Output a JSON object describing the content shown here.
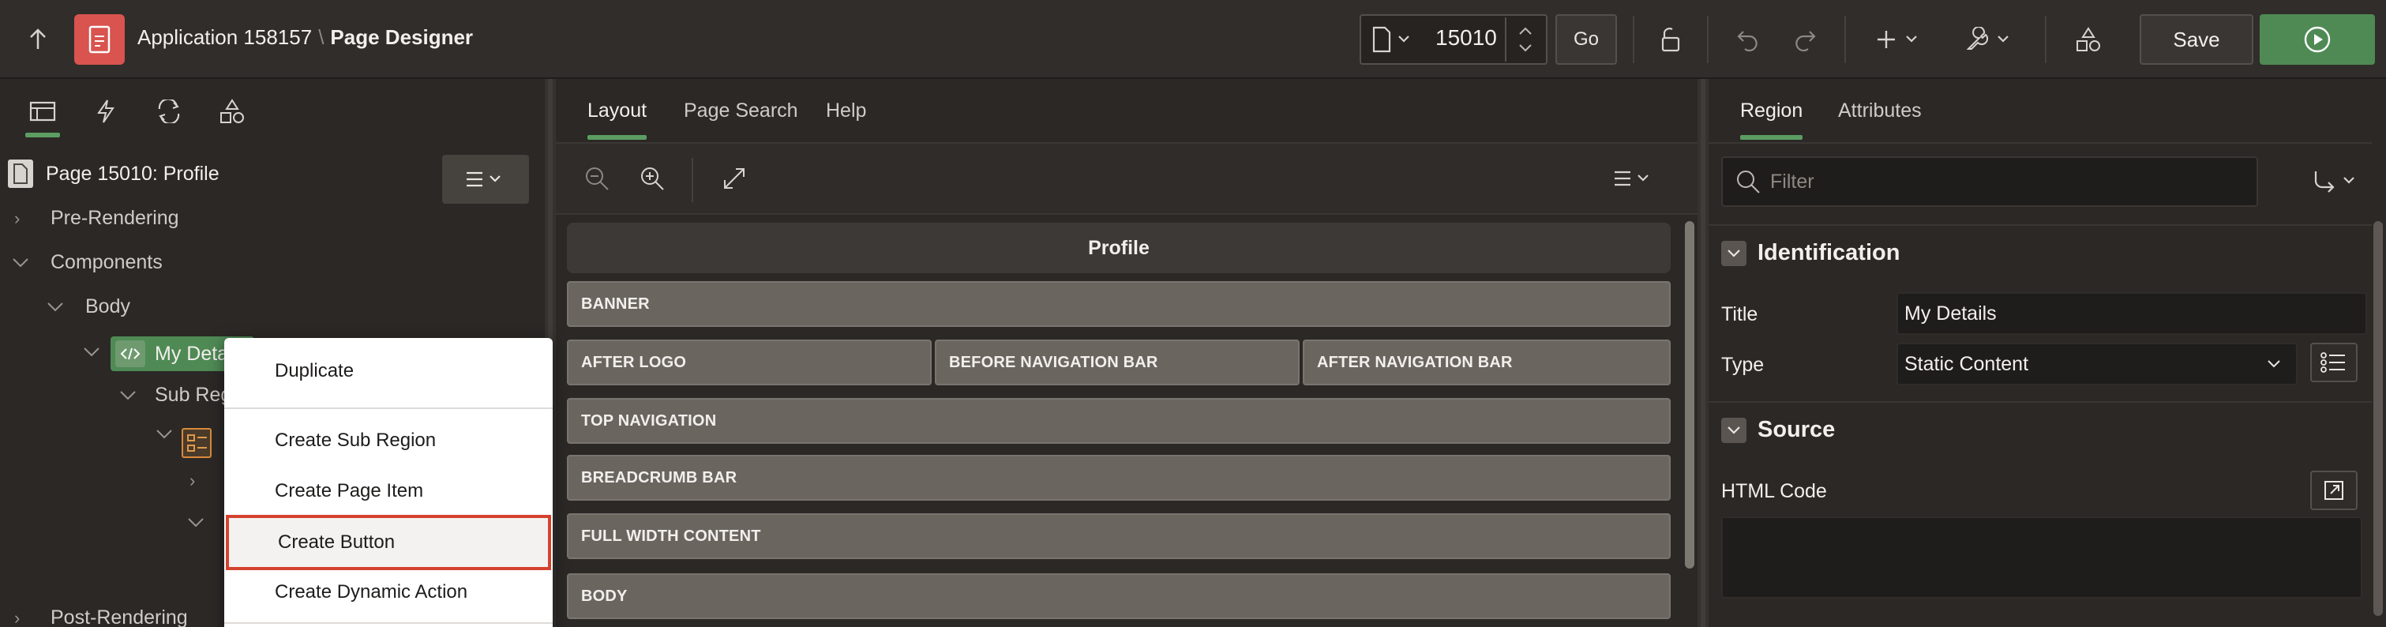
{
  "header": {
    "app_name": "Application 158157",
    "separator": "\\",
    "page_designer": "Page Designer",
    "page_number": "15010",
    "go_label": "Go",
    "save_label": "Save"
  },
  "left": {
    "page_title": "Page 15010: Profile",
    "tree": {
      "pre_rendering": "Pre-Rendering",
      "components": "Components",
      "body": "Body",
      "my_details": "My Details",
      "sub_regions": "Sub Regions",
      "post_rendering": "Post-Rendering"
    }
  },
  "context_menu": {
    "items": [
      "Duplicate",
      "Create Sub Region",
      "Create Page Item",
      "Create Button",
      "Create Dynamic Action"
    ],
    "highlighted": "Create Button"
  },
  "middle": {
    "tabs": [
      "Layout",
      "Page Search",
      "Help"
    ],
    "active_tab": "Layout",
    "page_header": "Profile",
    "slots": {
      "banner": "BANNER",
      "after_logo": "AFTER LOGO",
      "before_nav": "BEFORE NAVIGATION BAR",
      "after_nav": "AFTER NAVIGATION BAR",
      "top_navigation": "TOP NAVIGATION",
      "breadcrumb_bar": "BREADCRUMB BAR",
      "full_width": "FULL WIDTH CONTENT",
      "body": "BODY"
    }
  },
  "right": {
    "tabs": [
      "Region",
      "Attributes"
    ],
    "active_tab": "Region",
    "filter_placeholder": "Filter",
    "identification": {
      "heading": "Identification",
      "title_label": "Title",
      "title_value": "My Details",
      "type_label": "Type",
      "type_value": "Static Content"
    },
    "source": {
      "heading": "Source",
      "html_code_label": "HTML Code",
      "html_code_value": ""
    }
  },
  "colors": {
    "accent_green": "#5c9d62",
    "run_button": "#4f8a55",
    "app_icon": "#d9534f",
    "highlight_border": "#d4422f"
  }
}
